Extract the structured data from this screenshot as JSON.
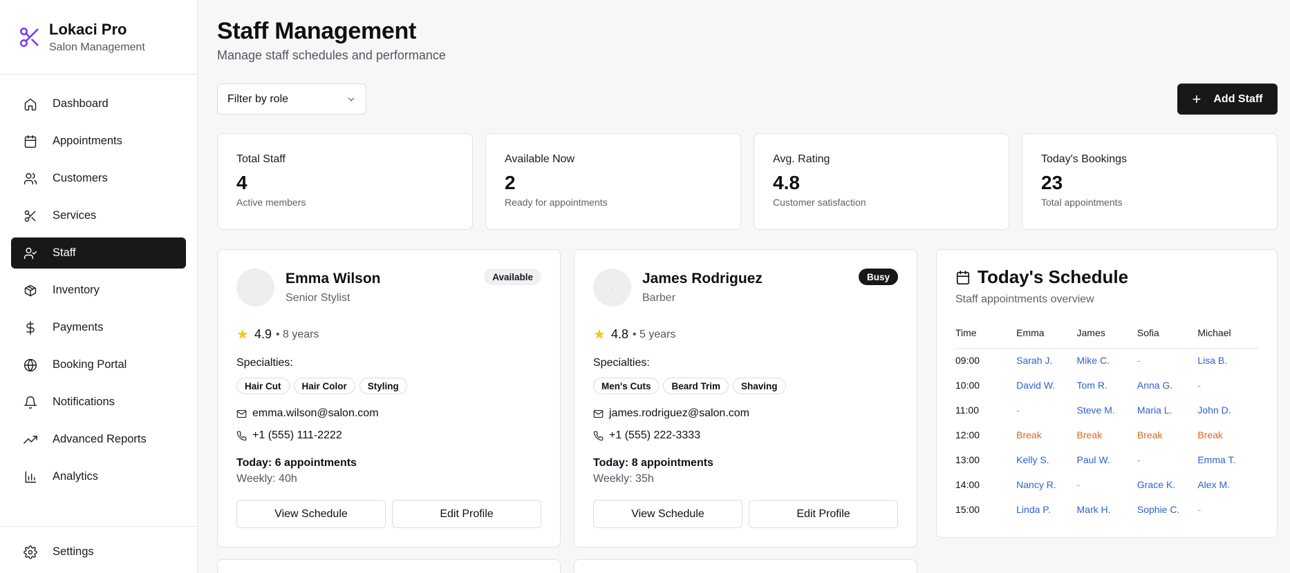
{
  "brand": {
    "title": "Lokaci Pro",
    "subtitle": "Salon Management"
  },
  "nav": {
    "items": [
      {
        "label": "Dashboard",
        "icon": "home-icon"
      },
      {
        "label": "Appointments",
        "icon": "calendar-icon"
      },
      {
        "label": "Customers",
        "icon": "users-icon"
      },
      {
        "label": "Services",
        "icon": "scissors-icon"
      },
      {
        "label": "Staff",
        "icon": "user-check-icon"
      },
      {
        "label": "Inventory",
        "icon": "package-icon"
      },
      {
        "label": "Payments",
        "icon": "dollar-icon"
      },
      {
        "label": "Booking Portal",
        "icon": "globe-icon"
      },
      {
        "label": "Notifications",
        "icon": "bell-icon"
      },
      {
        "label": "Advanced Reports",
        "icon": "trending-up-icon"
      },
      {
        "label": "Analytics",
        "icon": "bar-chart-icon"
      }
    ],
    "active": "Staff",
    "settings": "Settings"
  },
  "header": {
    "title": "Staff Management",
    "subtitle": "Manage staff schedules and performance"
  },
  "filter": {
    "label": "Filter by role"
  },
  "add_button": {
    "label": "Add Staff"
  },
  "stats": [
    {
      "label": "Total Staff",
      "value": "4",
      "note": "Active members"
    },
    {
      "label": "Available Now",
      "value": "2",
      "note": "Ready for appointments"
    },
    {
      "label": "Avg. Rating",
      "value": "4.8",
      "note": "Customer satisfaction"
    },
    {
      "label": "Today's Bookings",
      "value": "23",
      "note": "Total appointments"
    }
  ],
  "staff": [
    {
      "name": "Emma Wilson",
      "role": "Senior Stylist",
      "status": "Available",
      "rating": "4.9",
      "experience": "• 8 years",
      "specialties_label": "Specialties:",
      "specialties": [
        "Hair Cut",
        "Hair Color",
        "Styling"
      ],
      "email": "emma.wilson@salon.com",
      "phone": "+1 (555) 111-2222",
      "today": "Today: 6 appointments",
      "weekly": "Weekly: 40h",
      "view_label": "View Schedule",
      "edit_label": "Edit Profile"
    },
    {
      "name": "James Rodriguez",
      "role": "Barber",
      "status": "Busy",
      "rating": "4.8",
      "experience": "• 5 years",
      "specialties_label": "Specialties:",
      "specialties": [
        "Men's Cuts",
        "Beard Trim",
        "Shaving"
      ],
      "email": "james.rodriguez@salon.com",
      "phone": "+1 (555) 222-3333",
      "today": "Today: 8 appointments",
      "weekly": "Weekly: 35h",
      "view_label": "View Schedule",
      "edit_label": "Edit Profile"
    }
  ],
  "schedule": {
    "title": "Today's Schedule",
    "subtitle": "Staff appointments overview",
    "headers": [
      "Time",
      "Emma",
      "James",
      "Sofia",
      "Michael"
    ],
    "rows": [
      [
        "09:00",
        "Sarah J.",
        "Mike C.",
        "-",
        "Lisa B."
      ],
      [
        "10:00",
        "David W.",
        "Tom R.",
        "Anna G.",
        "-"
      ],
      [
        "11:00",
        "-",
        "Steve M.",
        "Maria L.",
        "John D."
      ],
      [
        "12:00",
        "Break",
        "Break",
        "Break",
        "Break"
      ],
      [
        "13:00",
        "Kelly S.",
        "Paul W.",
        "-",
        "Emma T."
      ],
      [
        "14:00",
        "Nancy R.",
        "-",
        "Grace K.",
        "Alex M."
      ],
      [
        "15:00",
        "Linda P.",
        "Mark H.",
        "Sophie C.",
        "-"
      ]
    ],
    "colors": {
      "client": "#2f5fd0",
      "break": "#e0651d",
      "empty": "#9a9aa2"
    }
  },
  "colors": {
    "accent": "#18181b",
    "brand": "#7c3aed",
    "star": "#f5c518"
  }
}
